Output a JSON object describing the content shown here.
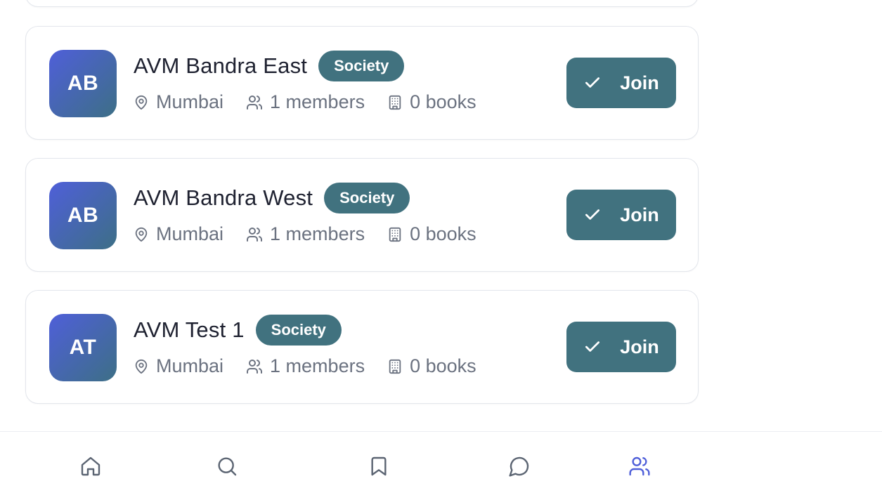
{
  "groups": [
    {
      "initials": "AB",
      "name": "AVM Bandra East",
      "type": "Society",
      "location": "Mumbai",
      "members": "1 members",
      "books": "0 books",
      "action": "Join"
    },
    {
      "initials": "AB",
      "name": "AVM Bandra West",
      "type": "Society",
      "location": "Mumbai",
      "members": "1 members",
      "books": "0 books",
      "action": "Join"
    },
    {
      "initials": "AT",
      "name": "AVM Test 1",
      "type": "Society",
      "location": "Mumbai",
      "members": "1 members",
      "books": "0 books",
      "action": "Join"
    }
  ],
  "bottom_nav": [
    {
      "icon": "home-icon",
      "active": false
    },
    {
      "icon": "search-icon",
      "active": false
    },
    {
      "icon": "bookmark-icon",
      "active": false
    },
    {
      "icon": "chat-icon",
      "active": false
    },
    {
      "icon": "users-icon",
      "active": true
    }
  ],
  "colors": {
    "accent": "#41727f",
    "nav_active": "#4f5fd9",
    "nav_inactive": "#5b6472",
    "avatar_gradient_start": "#4f5fd9",
    "avatar_gradient_end": "#3d6f86"
  }
}
